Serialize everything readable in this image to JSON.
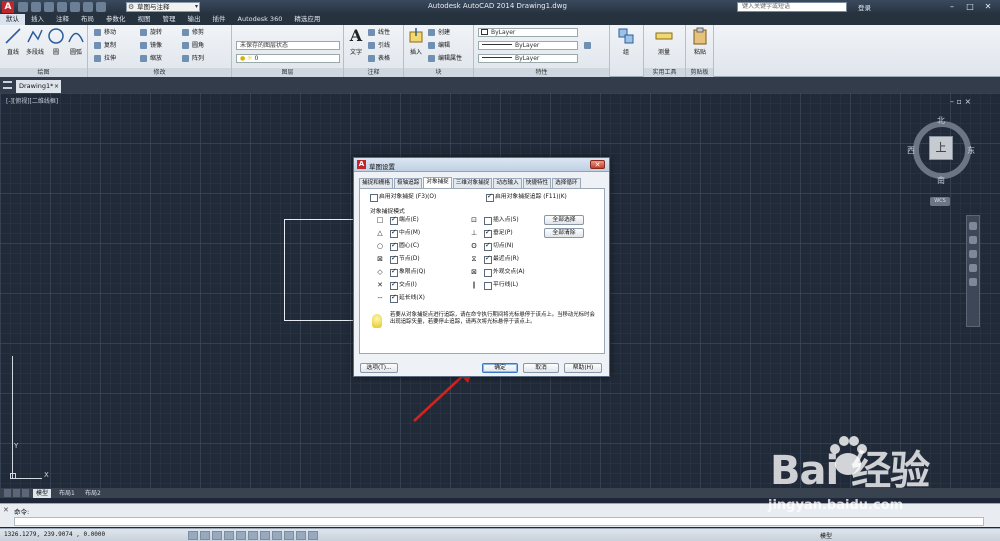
{
  "titlebar": {
    "logo": "A",
    "workspace": "草图与注释",
    "app_title": "Autodesk AutoCAD 2014    Drawing1.dwg",
    "search_placeholder": "键入关键字或短语",
    "login": "登录",
    "minimize": "–",
    "maximize": "□",
    "close": "✕"
  },
  "ribbon_tabs": [
    "默认",
    "插入",
    "注释",
    "布局",
    "参数化",
    "视图",
    "管理",
    "输出",
    "插件",
    "Autodesk 360",
    "精选应用"
  ],
  "ribbon": {
    "draw": {
      "title": "绘图",
      "line": "直线",
      "polyline": "多段线",
      "circle": "圆",
      "arc": "圆弧"
    },
    "modify": {
      "title": "修改",
      "move": "移动",
      "rotate": "旋转",
      "trim": "修剪",
      "copy": "复制",
      "mirror": "镜像",
      "fillet": "圆角",
      "stretch": "拉伸",
      "scale": "缩放",
      "array": "阵列"
    },
    "layers": {
      "title": "图层",
      "state": "未保存的图层状态",
      "current": "0"
    },
    "annotation": {
      "title": "注释",
      "text": "文字",
      "linear": "线性",
      "leader": "引线",
      "table": "表格"
    },
    "block": {
      "title": "块",
      "insert": "插入",
      "create": "创建",
      "edit": "编辑",
      "edit_attr": "编辑属性"
    },
    "properties": {
      "title": "特性",
      "color": "ByLayer",
      "linetype": "ByLayer",
      "lineweight": "ByLayer"
    },
    "group": {
      "label": "组"
    },
    "utilities": {
      "title": "实用工具",
      "measure": "测量"
    },
    "clipboard": {
      "title": "剪贴板",
      "paste": "粘贴"
    }
  },
  "filetab": {
    "label": "Drawing1*",
    "close": "×"
  },
  "canvas": {
    "viewport_label": "[-][俯视][二维线框]",
    "controls": "– ▫ ×"
  },
  "viewcube": {
    "north": "北",
    "south": "南",
    "east": "东",
    "west": "西",
    "face": "上",
    "wcs": "WCS"
  },
  "ucs": {
    "y": "Y",
    "x": "X"
  },
  "layout_tabs": [
    "模型",
    "布局1",
    "布局2"
  ],
  "command": {
    "history": "命令:",
    "input_placeholder": "",
    "close": "✕"
  },
  "status": {
    "coords": "1326.1279, 239.9074 , 0.0000",
    "model": "模型"
  },
  "watermark": {
    "brand": "Bai  经验",
    "url": "jingyan.baidu.com"
  },
  "dialog": {
    "title": "草图设置",
    "tabs": [
      "捕捉和栅格",
      "极轴追踪",
      "对象捕捉",
      "三维对象捕捉",
      "动态输入",
      "快捷特性",
      "选择循环"
    ],
    "active_tab": "对象捕捉",
    "enable_osnap": "启用对象捕捉 (F3)(O)",
    "enable_tracking": "启用对象捕捉追踪 (F11)(K)",
    "modes_label": "对象捕捉模式",
    "modes_left": [
      {
        "mark": "□",
        "label": "端点(E)",
        "checked": true
      },
      {
        "mark": "△",
        "label": "中点(M)",
        "checked": true
      },
      {
        "mark": "○",
        "label": "圆心(C)",
        "checked": true
      },
      {
        "mark": "⊠",
        "label": "节点(D)",
        "checked": true
      },
      {
        "mark": "◇",
        "label": "象限点(Q)",
        "checked": true
      },
      {
        "mark": "✕",
        "label": "交点(I)",
        "checked": true
      },
      {
        "mark": "--",
        "label": "延长线(X)",
        "checked": true
      }
    ],
    "modes_right": [
      {
        "mark": "⊡",
        "label": "插入点(S)",
        "checked": false
      },
      {
        "mark": "⊥",
        "label": "垂足(P)",
        "checked": true
      },
      {
        "mark": "ʘ",
        "label": "切点(N)",
        "checked": true
      },
      {
        "mark": "⧖",
        "label": "最近点(R)",
        "checked": true
      },
      {
        "mark": "⊠",
        "label": "外观交点(A)",
        "checked": false
      },
      {
        "mark": "∥",
        "label": "平行线(L)",
        "checked": false
      }
    ],
    "select_all": "全部选择",
    "clear_all": "全部清除",
    "info": "若要从对象捕捉点进行追踪，请在命令执行期间将光标悬停于该点上。当移动光标时会出现追踪矢量，若要停止追踪，请再次将光标悬停于该点上。",
    "options": "选项(T)...",
    "ok": "确定",
    "cancel": "取消",
    "help": "帮助(H)"
  }
}
